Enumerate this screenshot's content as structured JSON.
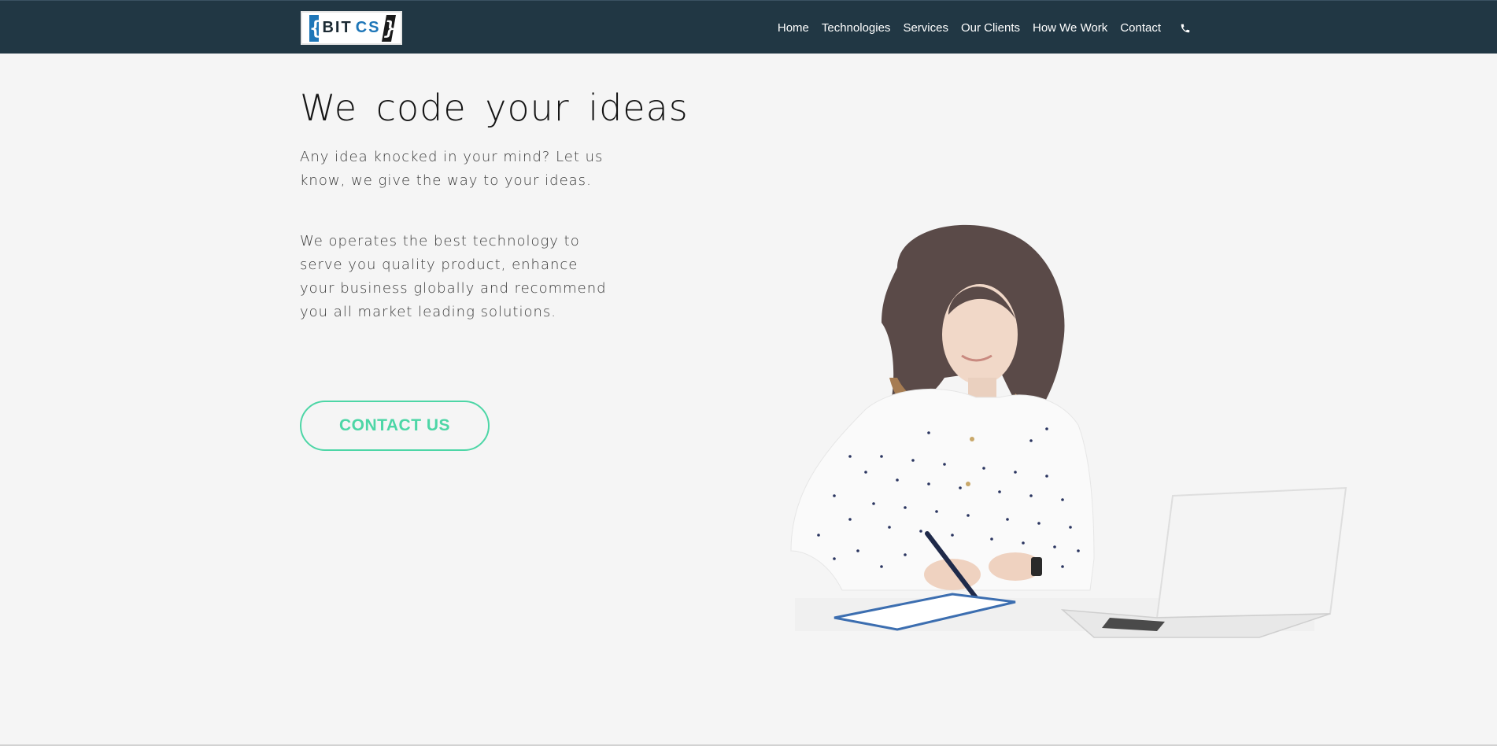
{
  "brand": {
    "logo_text_bit": "BIT",
    "logo_text_cs": "CS",
    "logo_brace_left": "{",
    "logo_brace_right": "}",
    "colors": {
      "nav_bg": "#213744",
      "accent": "#4dd6a6",
      "logo_blue": "#1e76b8"
    }
  },
  "nav": {
    "items": [
      {
        "label": "Home"
      },
      {
        "label": "Technologies"
      },
      {
        "label": "Services"
      },
      {
        "label": "Our Clients"
      },
      {
        "label": "How We Work"
      },
      {
        "label": "Contact"
      }
    ],
    "phone_icon": "phone-icon"
  },
  "hero": {
    "title": "We code your ideas",
    "subtitle": "Any idea knocked in your mind? Let us know, we give the way to your ideas.",
    "description": "We operates the best technology to serve you quality product, enhance your business globally and recommend you all market leading solutions.",
    "cta_label": "CONTACT US",
    "image": "woman-writing-at-desk-with-laptop"
  }
}
